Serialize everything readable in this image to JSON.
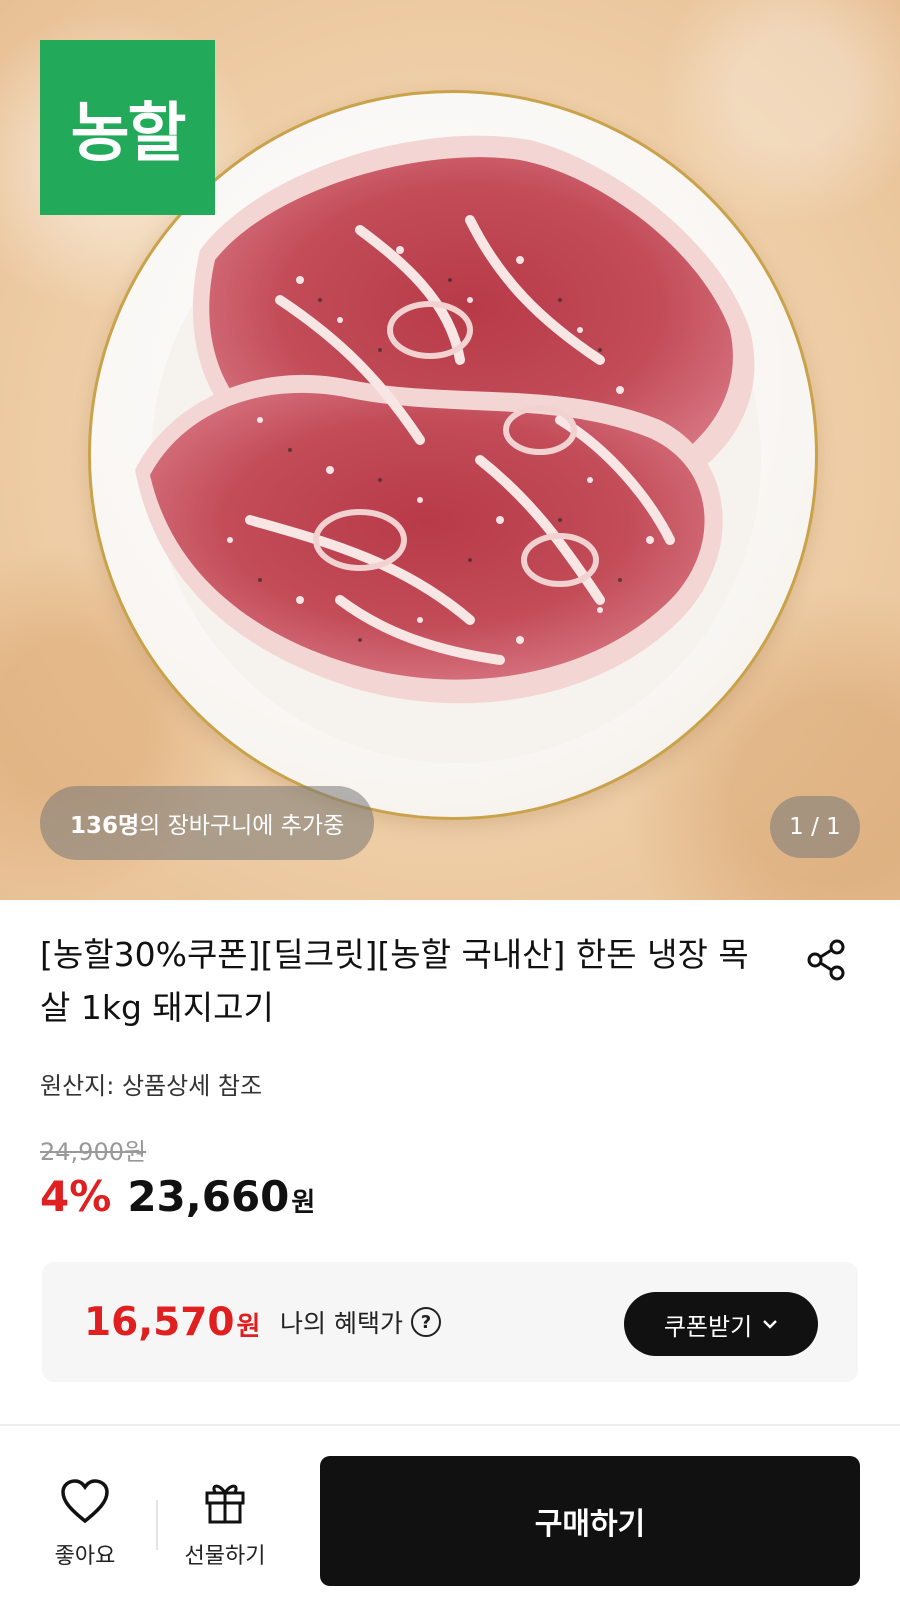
{
  "hero": {
    "logo_text": "농할",
    "logo_color": "#22a95a",
    "cart_count": "136명",
    "cart_text": "의 장바구니에 추가중",
    "page_indicator": "1 / 1"
  },
  "product": {
    "title": "[농할30%쿠폰][딜크릿][농할 국내산] 한돈 냉장 목살 1kg 돼지고기",
    "origin": "원산지: 상품상세 참조",
    "original_price": "24,900원",
    "discount": "4%",
    "price": "23,660",
    "price_unit": "원",
    "share_icon": "share-icon"
  },
  "benefit": {
    "price": "16,570",
    "price_unit": "원",
    "label": "나의 혜택가",
    "help_icon": "?",
    "coupon_button": "쿠폰받기",
    "accent_color": "#e02020"
  },
  "bottom_bar": {
    "like_label": "좋아요",
    "gift_label": "선물하기",
    "buy_label": "구매하기"
  }
}
